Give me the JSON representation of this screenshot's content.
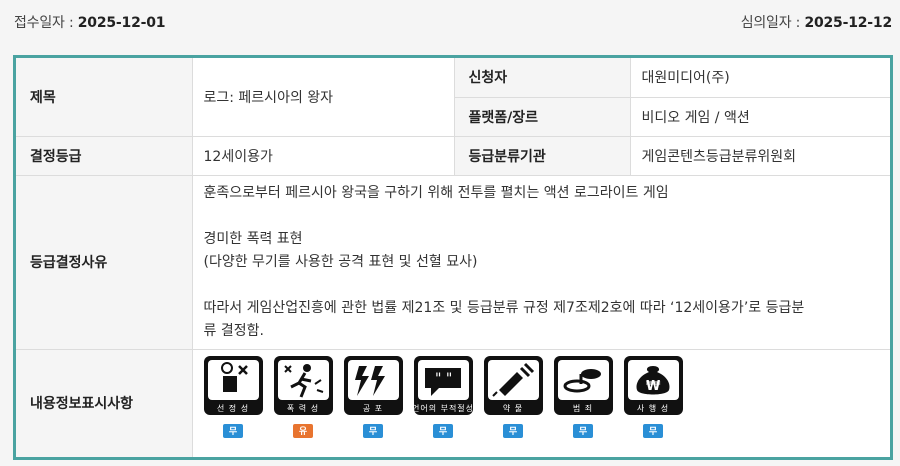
{
  "header": {
    "received_label": "접수일자 : ",
    "received_date": "2025-12-01",
    "review_label": "심의일자 : ",
    "review_date": "2025-12-12"
  },
  "rows": {
    "title_label": "제목",
    "title_value": "로그: 페르시아의 왕자",
    "applicant_label": "신청자",
    "applicant_value": "대원미디어(주)",
    "platform_label": "플랫폼/장르",
    "platform_value": "비디오 게임 /  액션",
    "rating_label": "결정등급",
    "rating_value": "12세이용가",
    "agency_label": "등급분류기관",
    "agency_value": "게임콘텐츠등급분류위원회",
    "reason_label": "등급결정사유",
    "reason_lines": [
      "훈족으로부터 페르시아 왕국을 구하기 위해 전투를 펼치는 액션 로그라이트 게임",
      "",
      "경미한 폭력 표현",
      "(다양한 무기를 사용한 공격 표현 및 선혈 묘사)",
      "",
      "따라서 게임산업진흥에 관한 법률 제21조 및 등급분류 규정 제7조제2호에 따라 ‘12세이용가’로 등급분",
      "류 결정함."
    ],
    "content_label": "내용정보표시사항"
  },
  "content_icons": [
    {
      "name": "sexuality-icon",
      "caption": "선 정 성",
      "status": "무",
      "color": "#2a8fd6"
    },
    {
      "name": "violence-icon",
      "caption": "폭 력 성",
      "status": "유",
      "color": "#e8742f"
    },
    {
      "name": "fear-icon",
      "caption": "공    포",
      "status": "무",
      "color": "#2a8fd6"
    },
    {
      "name": "language-icon",
      "caption": "언어의 부적절성",
      "status": "무",
      "color": "#2a8fd6"
    },
    {
      "name": "drug-icon",
      "caption": "약    물",
      "status": "무",
      "color": "#2a8fd6"
    },
    {
      "name": "crime-icon",
      "caption": "범    죄",
      "status": "무",
      "color": "#2a8fd6"
    },
    {
      "name": "gambling-icon",
      "caption": "사 행 성",
      "status": "무",
      "color": "#2a8fd6"
    }
  ],
  "colors": {
    "accent_border": "#4aa3a1",
    "badge_none": "#2a8fd6",
    "badge_present": "#e8742f"
  }
}
